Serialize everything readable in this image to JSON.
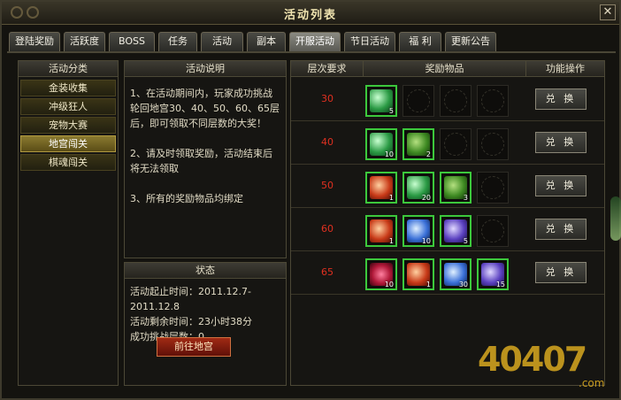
{
  "window": {
    "title": "活动列表",
    "close_label": "✕"
  },
  "tabs": [
    "登陆奖励",
    "活跃度",
    "BOSS",
    "任务",
    "活动",
    "副本",
    "开服活动",
    "节日活动",
    "福 利",
    "更新公告"
  ],
  "active_tab": 6,
  "categories": {
    "header": "活动分类",
    "items": [
      "金装收集",
      "冲级狂人",
      "宠物大赛",
      "地宫闯关",
      "棋魂闯关"
    ],
    "active": 3
  },
  "description": {
    "header": "活动说明",
    "text": "1、在活动期间内，玩家成功挑战轮回地宫30、40、50、60、65层后，即可领取不同层数的大奖！\n\n2、请及时领取奖励，活动结束后将无法领取\n\n3、所有的奖励物品均绑定"
  },
  "status": {
    "header": "状态",
    "start_label": "活动起止时间：2011.12.7-2011.12.8",
    "remaining_label": "活动剩余时间：23小时38分",
    "cleared_label": "成功挑战层数：0",
    "goto_button": "前往地宫"
  },
  "rewards_table": {
    "headers": [
      "层次要求",
      "奖励物品",
      "功能操作"
    ],
    "exchange_label": "兑 换",
    "rows": [
      {
        "level": "30",
        "items": [
          {
            "icon": "green-crystal-icon",
            "count": "5"
          },
          null,
          null,
          null
        ]
      },
      {
        "level": "40",
        "items": [
          {
            "icon": "green-crystal-icon",
            "count": "10"
          },
          {
            "icon": "herb-icon",
            "count": "2"
          },
          null,
          null
        ]
      },
      {
        "level": "50",
        "items": [
          {
            "icon": "red-armor-icon",
            "count": "1"
          },
          {
            "icon": "green-crystal-icon",
            "count": "20"
          },
          {
            "icon": "herb-icon",
            "count": "3"
          },
          null
        ]
      },
      {
        "level": "60",
        "items": [
          {
            "icon": "red-armor-icon",
            "count": "1"
          },
          {
            "icon": "blue-crystal-icon",
            "count": "10"
          },
          {
            "icon": "purple-gem-icon",
            "count": "5"
          },
          null
        ]
      },
      {
        "level": "65",
        "items": [
          {
            "icon": "ruby-orb-icon",
            "count": "10"
          },
          {
            "icon": "red-armor-icon",
            "count": "1"
          },
          {
            "icon": "blue-crystal-icon",
            "count": "30"
          },
          {
            "icon": "purple-gem-icon",
            "count": "15"
          }
        ]
      }
    ]
  },
  "watermark": {
    "text": "40407",
    "sub": ".com"
  },
  "colors": {
    "level_text": "#e03020",
    "item_border": "#3cc83c",
    "active_category": "#8a7a30"
  }
}
